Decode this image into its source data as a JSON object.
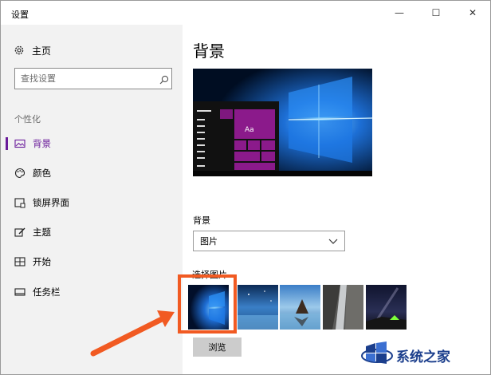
{
  "window": {
    "title": "设置",
    "minimize_glyph": "—",
    "maximize_glyph": "☐",
    "close_glyph": "✕"
  },
  "sidebar": {
    "home": {
      "label": "主页",
      "icon": "gear-icon"
    },
    "search": {
      "placeholder": "查找设置",
      "value": "",
      "icon": "search-icon"
    },
    "section_title": "个性化",
    "items": [
      {
        "label": "背景",
        "icon": "picture-icon",
        "active": true
      },
      {
        "label": "颜色",
        "icon": "palette-icon",
        "active": false
      },
      {
        "label": "锁屏界面",
        "icon": "lock-screen-icon",
        "active": false
      },
      {
        "label": "主题",
        "icon": "theme-brush-icon",
        "active": false
      },
      {
        "label": "开始",
        "icon": "start-grid-icon",
        "active": false
      },
      {
        "label": "任务栏",
        "icon": "taskbar-icon",
        "active": false
      }
    ]
  },
  "main": {
    "title": "背景",
    "preview": {
      "tile_text": "Aa"
    },
    "background_label": "背景",
    "background_dropdown": {
      "selected": "图片"
    },
    "choose_picture_label": "选择图片",
    "pictures": [
      {
        "name": "windows-hero",
        "selected": true
      },
      {
        "name": "beach-night",
        "selected": false
      },
      {
        "name": "coast-rocks",
        "selected": false
      },
      {
        "name": "waterfall-rock",
        "selected": false
      },
      {
        "name": "night-sky-tent",
        "selected": false
      }
    ],
    "browse_label": "浏览"
  },
  "accent_colors": {
    "active_nav": "#6a1b9a",
    "tile": "#8b1a8b",
    "highlight_box": "#f15a22"
  },
  "watermark": {
    "text": "系统之家"
  }
}
